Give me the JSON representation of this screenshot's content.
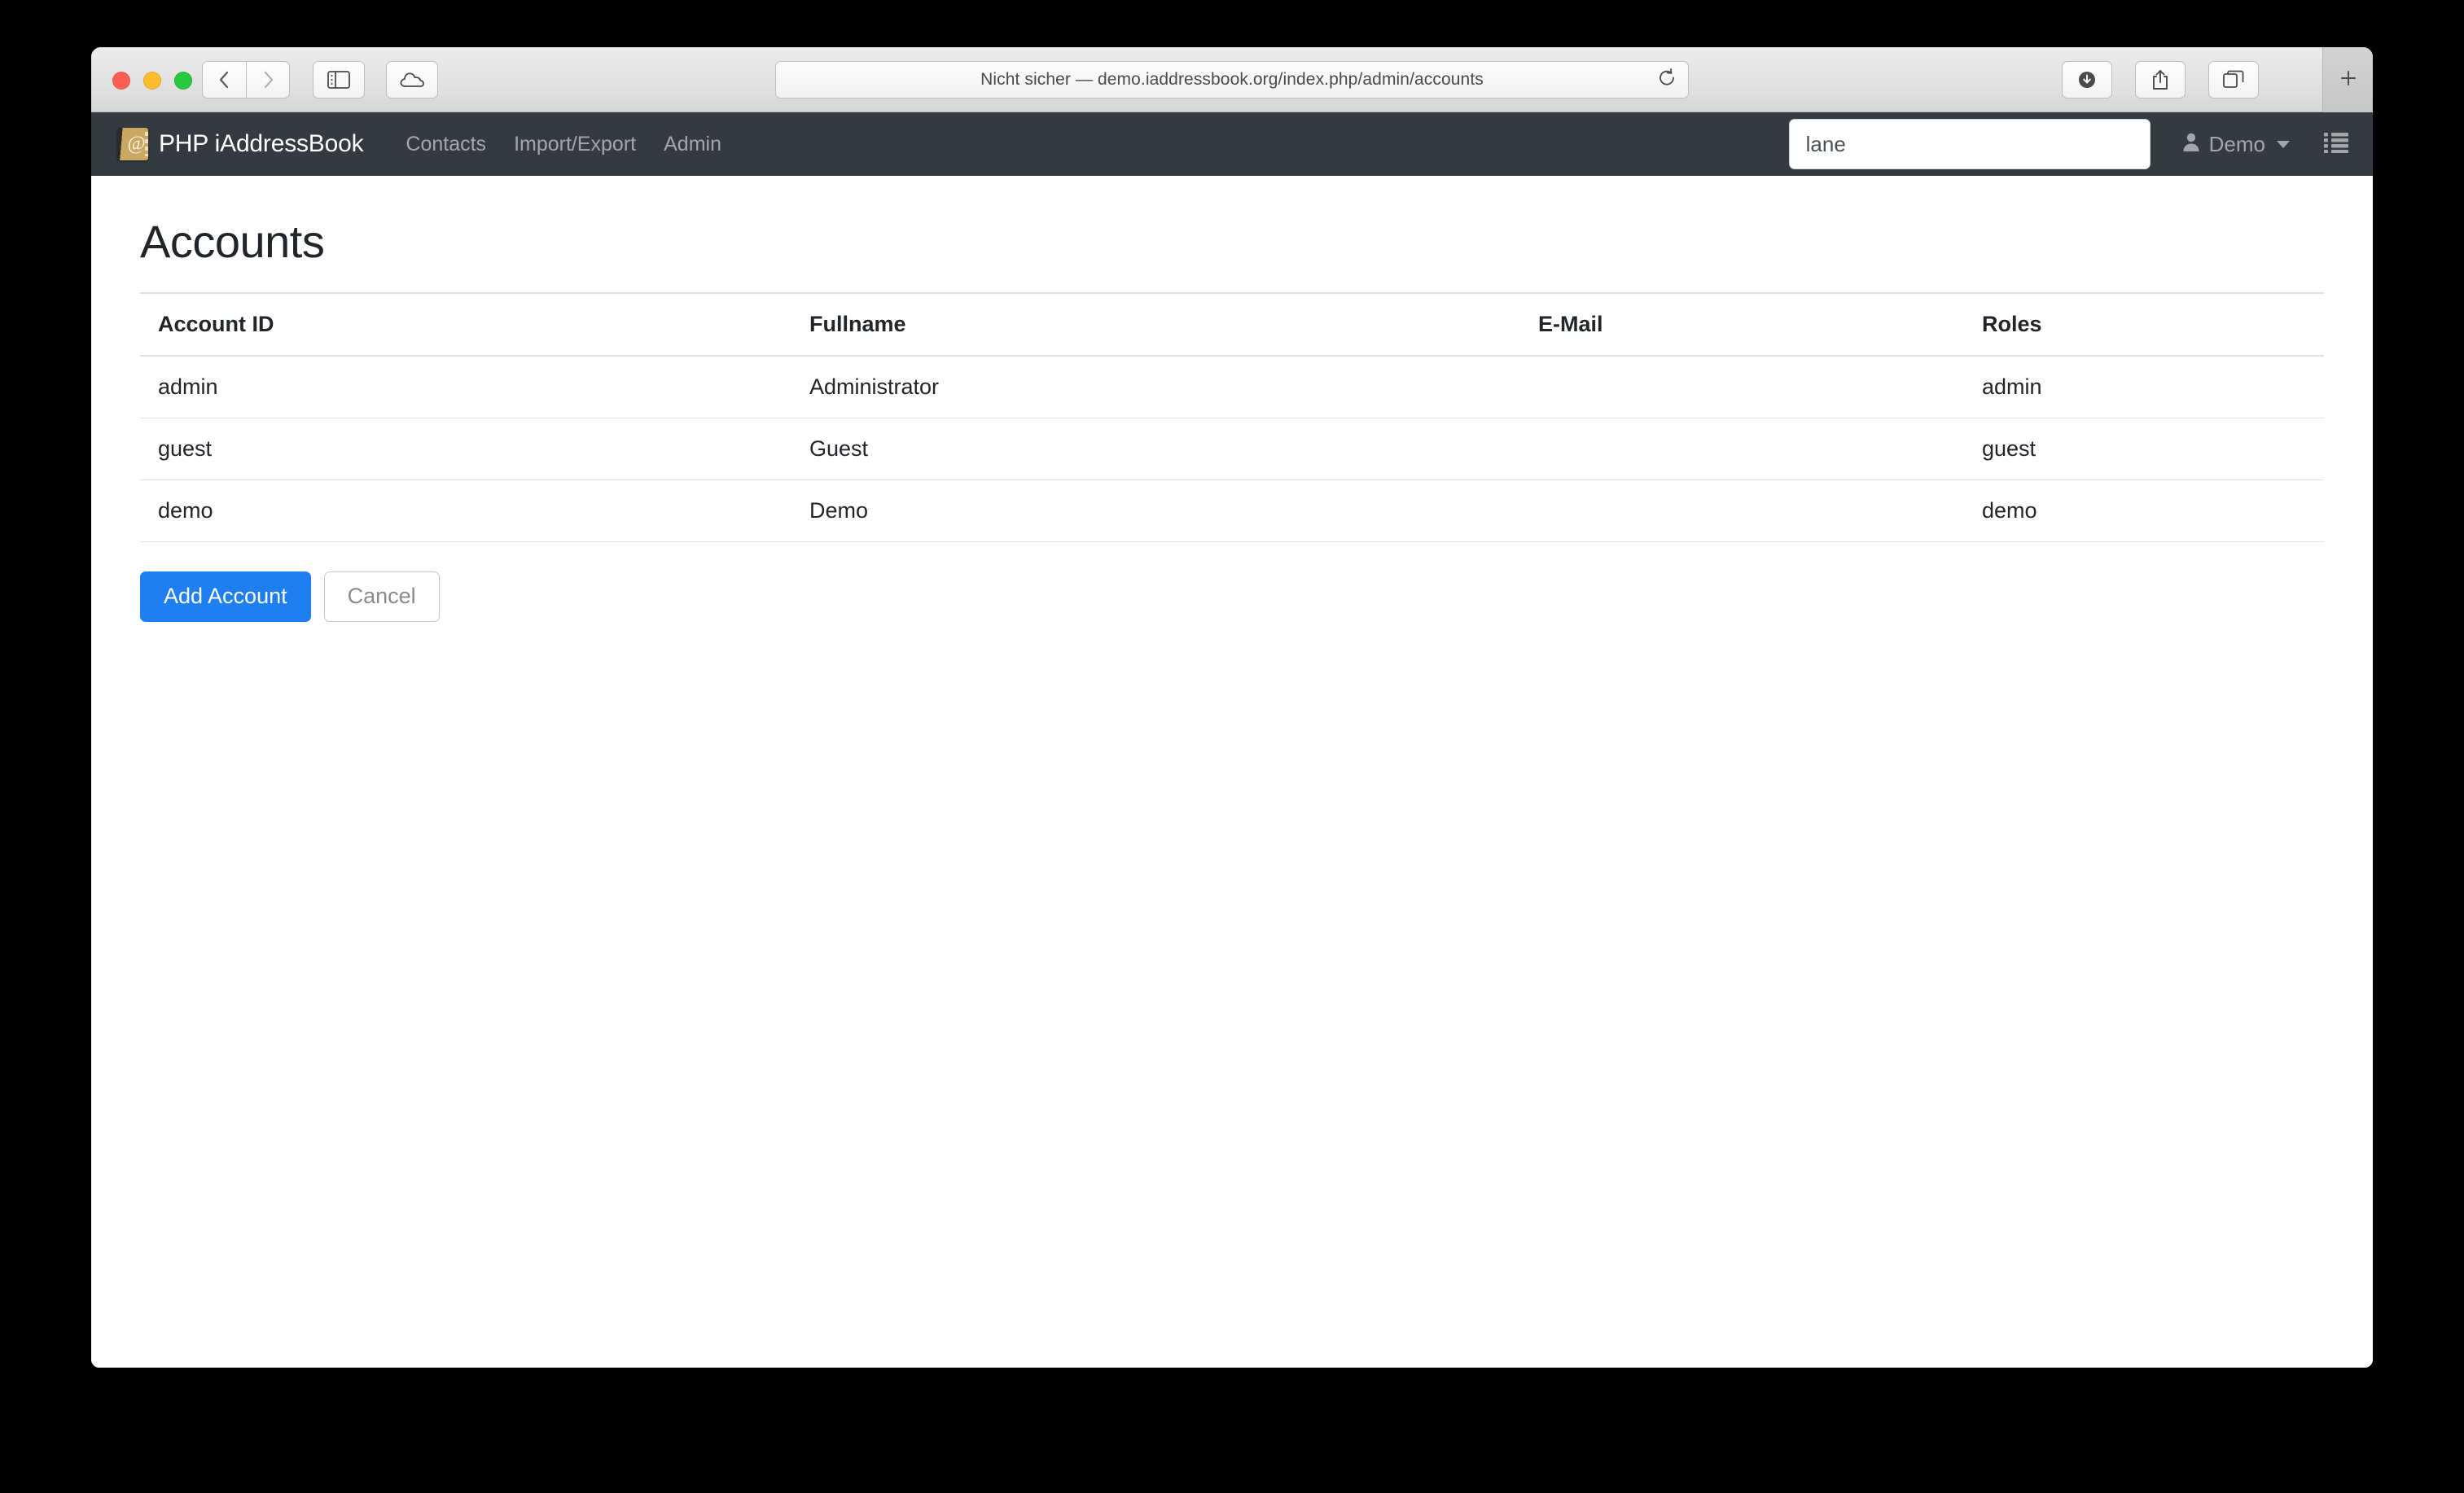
{
  "browser": {
    "url_text": "Nicht sicher — demo.iaddressbook.org/index.php/admin/accounts",
    "traffic_lights": [
      "close",
      "minimize",
      "zoom"
    ],
    "toolbar_icons": [
      "back-icon",
      "forward-icon",
      "sidebar-icon",
      "icloud-icon",
      "downloads-icon",
      "share-icon",
      "tab-overview-icon",
      "new-tab-icon",
      "reload-icon"
    ],
    "colors": {
      "close": "#ff5f57",
      "minimize": "#febc2e",
      "zoom": "#28c840"
    }
  },
  "navbar": {
    "brand": "PHP iAddressBook",
    "brand_icon": "addressbook-icon",
    "links": [
      {
        "label": "Contacts"
      },
      {
        "label": "Import/Export"
      },
      {
        "label": "Admin"
      }
    ],
    "search": {
      "value": "lane",
      "placeholder": ""
    },
    "user": {
      "name": "Demo",
      "icon": "user-icon",
      "caret": "chevron-down-icon"
    },
    "list_icon": "list-icon",
    "background_color": "#343a40"
  },
  "page": {
    "title": "Accounts"
  },
  "table": {
    "columns": [
      "Account ID",
      "Fullname",
      "E-Mail",
      "Roles"
    ],
    "rows": [
      {
        "account_id": "admin",
        "fullname": "Administrator",
        "email": "",
        "roles": "admin"
      },
      {
        "account_id": "guest",
        "fullname": "Guest",
        "email": "",
        "roles": "guest"
      },
      {
        "account_id": "demo",
        "fullname": "Demo",
        "email": "",
        "roles": "demo"
      }
    ]
  },
  "actions": {
    "add_label": "Add Account",
    "cancel_label": "Cancel",
    "primary_color": "#1f7ff1"
  }
}
